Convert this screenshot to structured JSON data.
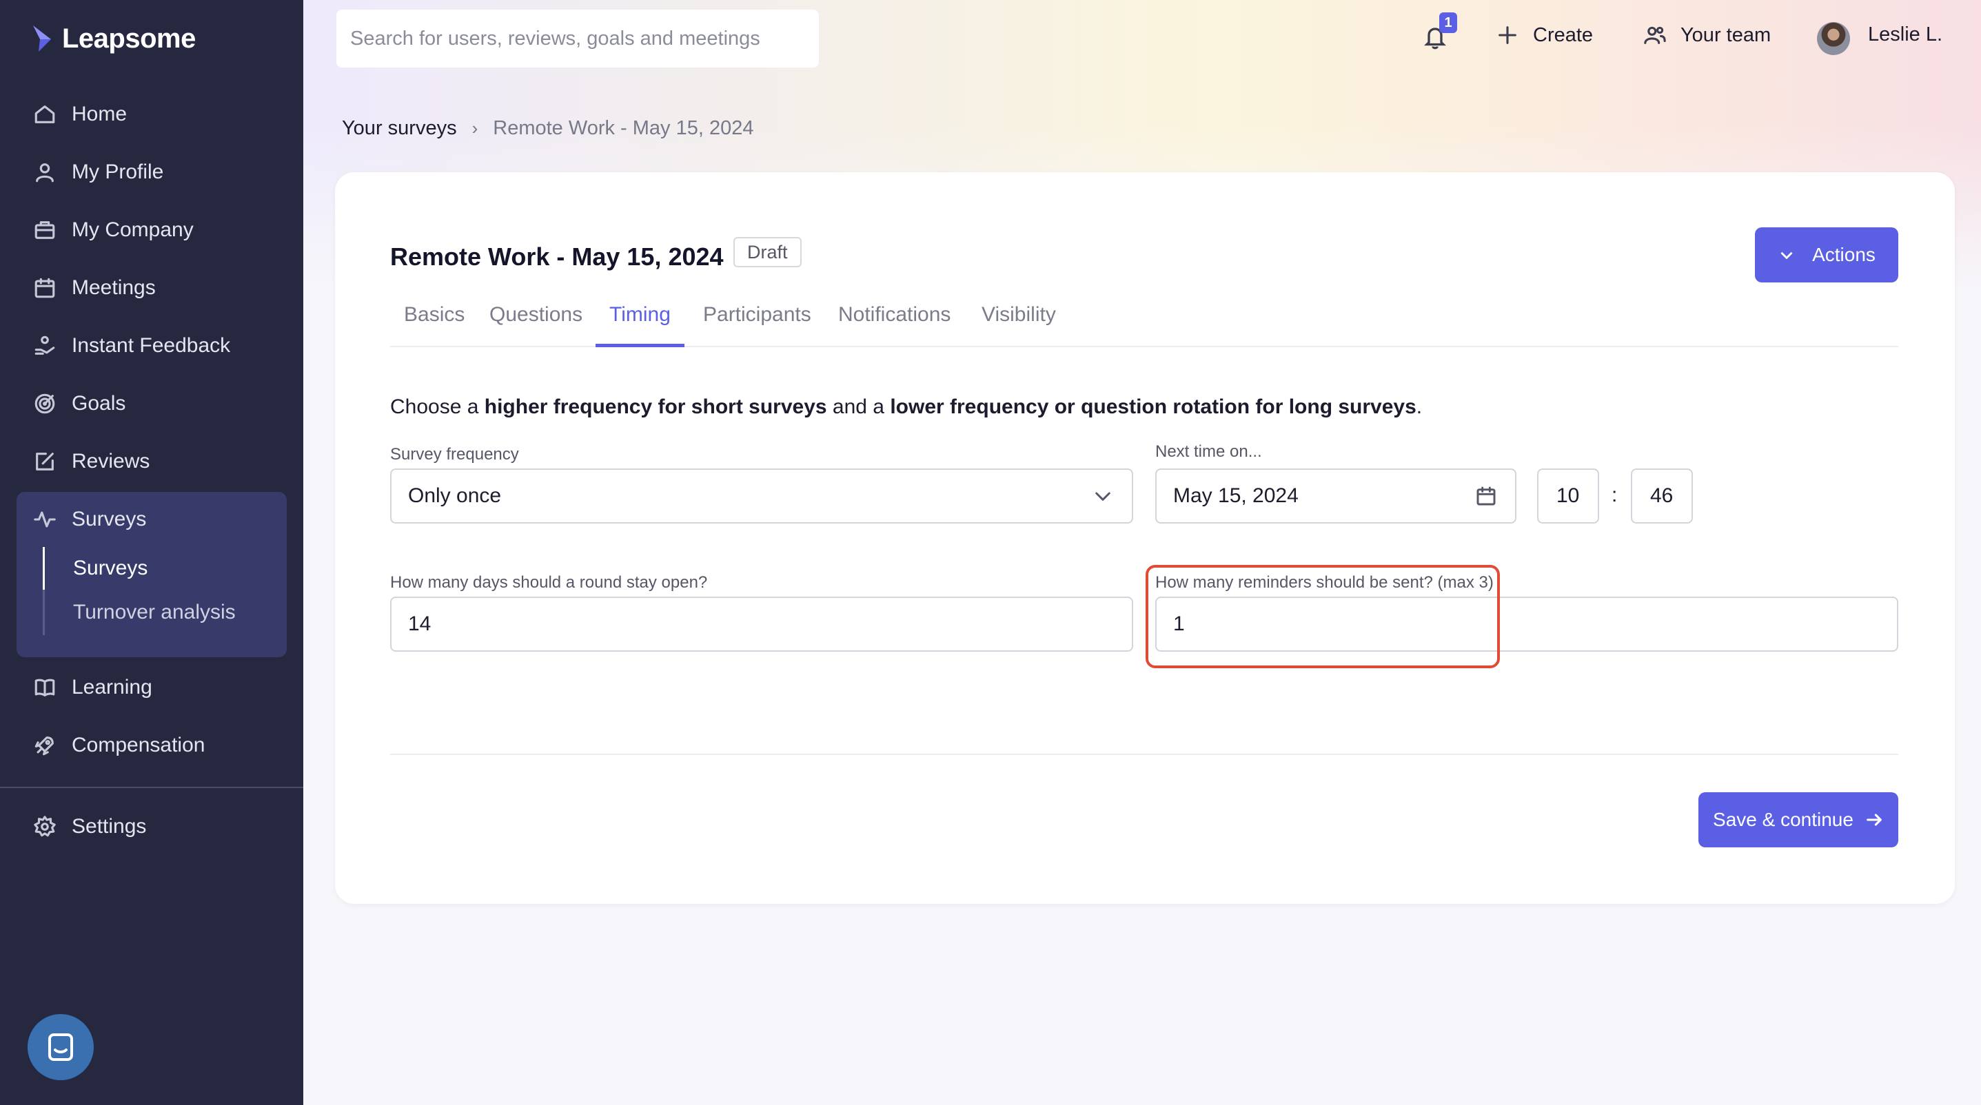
{
  "app": {
    "name": "Leapsome"
  },
  "sidebar": {
    "items": [
      {
        "label": "Home",
        "icon": "home-icon"
      },
      {
        "label": "My Profile",
        "icon": "user-icon"
      },
      {
        "label": "My Company",
        "icon": "briefcase-icon"
      },
      {
        "label": "Meetings",
        "icon": "calendar-icon"
      },
      {
        "label": "Instant Feedback",
        "icon": "feedback-hand-icon"
      },
      {
        "label": "Goals",
        "icon": "target-icon"
      },
      {
        "label": "Reviews",
        "icon": "edit-icon"
      },
      {
        "label": "Surveys",
        "icon": "pulse-icon"
      },
      {
        "label": "Learning",
        "icon": "book-icon"
      },
      {
        "label": "Compensation",
        "icon": "rocket-icon"
      },
      {
        "label": "Settings",
        "icon": "gear-icon"
      }
    ],
    "sub_items": [
      {
        "label": "Surveys",
        "active": true
      },
      {
        "label": "Turnover analysis",
        "active": false
      }
    ]
  },
  "header": {
    "search_placeholder": "Search for users, reviews, goals and meetings",
    "notifications_count": "1",
    "create_label": "Create",
    "team_label": "Your team",
    "user_name": "Leslie L."
  },
  "breadcrumb": {
    "root": "Your surveys",
    "current": "Remote Work - May 15, 2024"
  },
  "survey": {
    "title": "Remote Work - May 15, 2024",
    "status": "Draft",
    "actions_label": "Actions",
    "tabs": [
      {
        "label": "Basics",
        "active": false
      },
      {
        "label": "Questions",
        "active": false
      },
      {
        "label": "Timing",
        "active": true
      },
      {
        "label": "Participants",
        "active": false
      },
      {
        "label": "Notifications",
        "active": false
      },
      {
        "label": "Visibility",
        "active": false
      }
    ]
  },
  "timing": {
    "intro_1": "Choose a ",
    "intro_2": "higher frequency for short surveys",
    "intro_3": " and a ",
    "intro_4": "lower frequency or question rotation for long surveys",
    "intro_5": ".",
    "frequency_label": "Survey frequency",
    "frequency_value": "Only once",
    "next_time_label": "Next time on...",
    "next_date": "May 15, 2024",
    "hour": "10",
    "minute": "46",
    "time_separator": ":",
    "days_open_label": "How many days should a round stay open?",
    "days_open_value": "14",
    "reminders_label": "How many reminders should be sent? (max 3)",
    "reminders_value": "1",
    "save_label": "Save & continue"
  },
  "colors": {
    "accent": "#5b5fe3",
    "sidebar_bg": "#262840",
    "highlight": "#e14b36"
  }
}
